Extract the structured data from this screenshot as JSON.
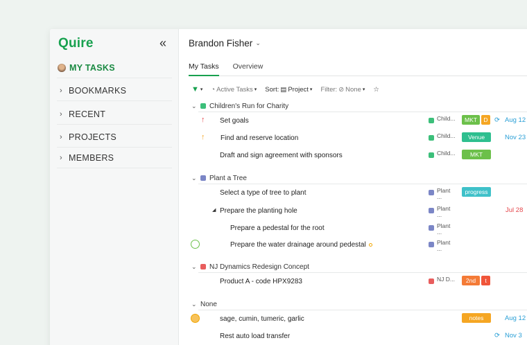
{
  "app": {
    "logo": "Quire"
  },
  "sidebar": {
    "collapse_icon": "double-chevron-left-icon",
    "items": [
      {
        "label": "MY TASKS"
      },
      {
        "label": "BOOKMARKS"
      },
      {
        "label": "RECENT"
      },
      {
        "label": "PROJECTS"
      },
      {
        "label": "MEMBERS"
      }
    ]
  },
  "header": {
    "user": "Brandon Fisher"
  },
  "tabs": [
    {
      "label": "My Tasks"
    },
    {
      "label": "Overview"
    }
  ],
  "toolbar": {
    "active_tasks": "Active Tasks",
    "sort_label": "Sort:",
    "sort_value": "Project",
    "filter_label": "Filter:",
    "filter_value": "None"
  },
  "groups": [
    {
      "name": "Children's Run for Charity",
      "color": "#3cbf7a"
    },
    {
      "name": "Plant a Tree",
      "color": "#7b86c6"
    },
    {
      "name": "NJ Dynamics Redesign Concept",
      "color": "#e85d5d"
    },
    {
      "name": "None"
    }
  ],
  "tasks": [
    {
      "title": "Set goals",
      "project": "Child...",
      "tags": [
        "MKT",
        "D"
      ],
      "date": "Aug 12"
    },
    {
      "title": "Find and reserve location",
      "project": "Child...",
      "tags": [
        "Venue"
      ],
      "date": "Nov 23"
    },
    {
      "title": "Draft and sign agreement with sponsors",
      "project": "Child...",
      "tags": [
        "MKT"
      ]
    },
    {
      "title": "Select a type of tree to plant",
      "project": "Plant",
      "project2": "...",
      "tags": [
        "progress"
      ]
    },
    {
      "title": "Prepare the planting hole",
      "project": "Plant",
      "project2": "...",
      "date": "Jul 28"
    },
    {
      "title": "Prepare a pedestal for the root",
      "project": "Plant",
      "project2": "..."
    },
    {
      "title": "Prepare the water drainage around pedestal",
      "project": "Plant",
      "project2": "..."
    },
    {
      "title": "Product A - code HPX9283",
      "project": "NJ D...",
      "tags": [
        "2nd",
        "t"
      ]
    },
    {
      "title": "sage, cumin, tumeric, garlic",
      "tags": [
        "notes"
      ],
      "date": "Aug 12"
    },
    {
      "title": "Rest auto load transfer",
      "date": "Nov 3"
    }
  ],
  "colors": {
    "brand": "#18a14f",
    "mkt": "#6cc04a",
    "d": "#f5a623",
    "venue": "#2ebf8f",
    "progress": "#3fc1c9",
    "second": "#f47b37",
    "t": "#f0553a",
    "notes": "#f5a623",
    "date_blue": "#2a9fd6",
    "date_red": "#e5484d"
  }
}
